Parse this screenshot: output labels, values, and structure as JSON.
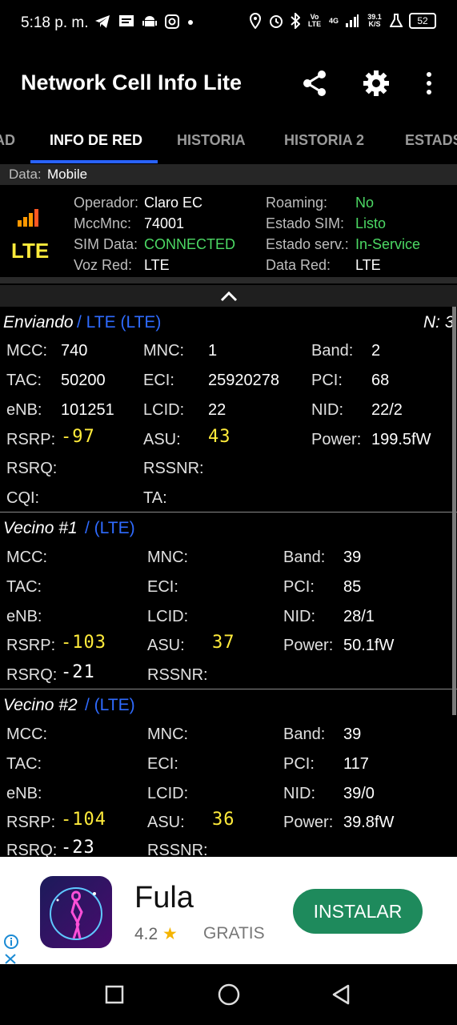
{
  "status_bar": {
    "time": "5:18 p. m.",
    "left_icons": [
      "telegram-icon",
      "message-icon",
      "android-icon",
      "instagram-icon",
      "dot-icon"
    ],
    "right_icons": [
      "location-icon",
      "alarm-icon",
      "bluetooth-icon",
      "volte-icon",
      "4g-icon",
      "signal-icon",
      "speed-icon",
      "lab-icon",
      "battery-icon"
    ],
    "volte": "Vo LTE",
    "net": "4G",
    "speed": "39.1 K/S",
    "battery": "52"
  },
  "app_bar": {
    "title": "Network Cell Info Lite",
    "actions": [
      "share-icon",
      "settings-icon",
      "more-icon"
    ]
  },
  "tabs": [
    {
      "label": "AD",
      "active": false
    },
    {
      "label": "INFO DE RED",
      "active": true
    },
    {
      "label": "HISTORIA",
      "active": false
    },
    {
      "label": "HISTORIA 2",
      "active": false
    },
    {
      "label": "ESTADS",
      "active": false
    }
  ],
  "data_row": {
    "label": "Data:",
    "value": "Mobile"
  },
  "summary": {
    "tech": "LTE",
    "left": [
      {
        "label": "Operador:",
        "value": "Claro EC",
        "color": "#ffffff"
      },
      {
        "label": "MccMnc:",
        "value": "74001",
        "color": "#ffffff"
      },
      {
        "label": "SIM Data:",
        "value": "CONNECTED",
        "color": "#4cd964"
      },
      {
        "label": "Voz Red:",
        "value": "LTE",
        "color": "#ffffff"
      }
    ],
    "right": [
      {
        "label": "Roaming:",
        "value": "No",
        "color": "#4cd964"
      },
      {
        "label": "Estado SIM:",
        "value": "Listo",
        "color": "#4cd964"
      },
      {
        "label": "Estado serv.:",
        "value": "In-Service",
        "color": "#4cd964"
      },
      {
        "label": "Data Red:",
        "value": "LTE",
        "color": "#ffffff"
      }
    ]
  },
  "serving": {
    "title": "Enviando",
    "subtitle": "/ LTE (LTE)",
    "n_label": "N: 3",
    "mcc_label": "MCC:",
    "mcc": "740",
    "mnc_label": "MNC:",
    "mnc": "1",
    "band_label": "Band:",
    "band": "2",
    "tac_label": "TAC:",
    "tac": "50200",
    "eci_label": "ECI:",
    "eci": "25920278",
    "pci_label": "PCI:",
    "pci": "68",
    "enb_label": "eNB:",
    "enb": "101251",
    "lcid_label": "LCID:",
    "lcid": "22",
    "nid_label": "NID:",
    "nid": "22/2",
    "rsrp_label": "RSRP:",
    "rsrp": "-97",
    "asu_label": "ASU:",
    "asu": "43",
    "power_label": "Power:",
    "power": "199.5fW",
    "rsrq_label": "RSRQ:",
    "rssnr_label": "RSSNR:",
    "cqi_label": "CQI:",
    "ta_label": "TA:"
  },
  "neighbor1": {
    "title": "Vecino #1",
    "subtitle": "/ (LTE)",
    "mcc_label": "MCC:",
    "mnc_label": "MNC:",
    "band_label": "Band:",
    "band": "39",
    "tac_label": "TAC:",
    "eci_label": "ECI:",
    "pci_label": "PCI:",
    "pci": "85",
    "enb_label": "eNB:",
    "lcid_label": "LCID:",
    "nid_label": "NID:",
    "nid": "28/1",
    "rsrp_label": "RSRP:",
    "rsrp": "-103",
    "asu_label": "ASU:",
    "asu": "37",
    "power_label": "Power:",
    "power": "50.1fW",
    "rsrq_label": "RSRQ:",
    "rsrq": "-21",
    "rssnr_label": "RSSNR:"
  },
  "neighbor2": {
    "title": "Vecino #2",
    "subtitle": "/ (LTE)",
    "mcc_label": "MCC:",
    "mnc_label": "MNC:",
    "band_label": "Band:",
    "band": "39",
    "tac_label": "TAC:",
    "eci_label": "ECI:",
    "pci_label": "PCI:",
    "pci": "117",
    "enb_label": "eNB:",
    "lcid_label": "LCID:",
    "nid_label": "NID:",
    "nid": "39/0",
    "rsrp_label": "RSRP:",
    "rsrp": "-104",
    "asu_label": "ASU:",
    "asu": "36",
    "power_label": "Power:",
    "power": "39.8fW",
    "rsrq_label": "RSRQ:",
    "rsrq": "-23",
    "rssnr_label": "RSSNR:"
  },
  "ad": {
    "name": "Fula",
    "rating": "4.2",
    "price": "GRATIS",
    "install": "INSTALAR"
  },
  "nav": [
    "recents-icon",
    "home-icon",
    "back-icon"
  ],
  "colors": {
    "accent": "#2962ff",
    "green": "#4cd964",
    "yellow": "#ffeb3b",
    "blue": "#2f6bff",
    "install": "#1e8a5c"
  }
}
